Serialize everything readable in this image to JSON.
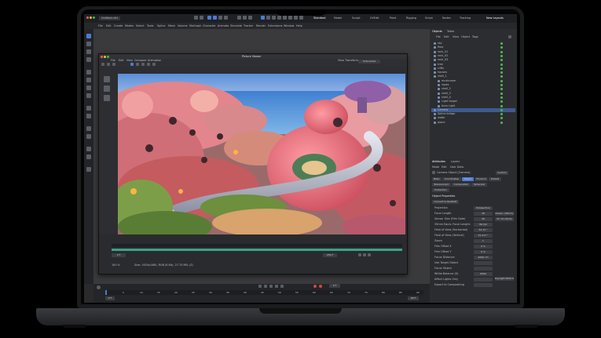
{
  "topbar": {
    "file_tab": "Untitled.c4d",
    "layouts": [
      "Standard",
      "Model",
      "Sculpt",
      "UVEdit",
      "Paint",
      "Rigging",
      "Script",
      "Nodes",
      "Tracking"
    ],
    "new_layouts": "New Layouts"
  },
  "menubar": {
    "items": [
      "File",
      "Edit",
      "Create",
      "Modes",
      "Select",
      "Tools",
      "Spline",
      "Mesh",
      "Volume",
      "MoGraph",
      "Character",
      "Animate",
      "Simulate",
      "Tracker",
      "Render",
      "Extensions",
      "Window",
      "Help"
    ]
  },
  "picture_viewer": {
    "title": "Picture Viewer",
    "menu": [
      "File",
      "Edit",
      "View",
      "Compare",
      "Animation"
    ],
    "view_transform_label": "View Transform",
    "view_transform_value": "Untouched",
    "zoom": "100 %",
    "status": "Size: 1920x1080, RGB (8 Bit), 27.75 MB; (Z)",
    "frame": "0 F",
    "end_frame": "250 F"
  },
  "objects_panel": {
    "tabs": [
      "Objects",
      "Takes"
    ],
    "menu": [
      "File",
      "Edit",
      "View",
      "Object",
      "Tags"
    ],
    "rows": [
      "sky",
      "floor",
      "rock_01",
      "rock_02",
      "rock_03",
      "tree",
      "cliffs",
      "houses",
      "shell_1",
      "mushroom",
      "ropes",
      "shell_2",
      "shell_3",
      "shell_4",
      "Light target",
      "Area Light",
      "Camera",
      "Spline bridge",
      "water",
      "plane"
    ]
  },
  "attributes_panel": {
    "tabs": [
      "Attributes",
      "Layers"
    ],
    "menu": [
      "Mode",
      "Edit",
      "User Data"
    ],
    "object_name": "Camera Object [Camera]",
    "preset": "Custom",
    "sub_tabs": [
      "Basic",
      "Coordinates",
      "Object",
      "Physical",
      "Details",
      "Stereoscopic",
      "Composition",
      "Spherical"
    ],
    "sub_tab2": "Protection",
    "section": "Object Properties",
    "convert_btn": "Convert to Redshift",
    "props": [
      {
        "label": "Projection",
        "value": "Perspective"
      },
      {
        "label": "Focal Length",
        "value": "36"
      },
      {
        "label": "Sensor Size (Film Gate)",
        "value": "36"
      },
      {
        "label": "35mm Equiv. Focal Length:",
        "value": "36 mm"
      },
      {
        "label": "Field of View (Horizontal)",
        "value": "53.13 °"
      },
      {
        "label": "Field of View (Vertical)",
        "value": "31.417 °"
      },
      {
        "label": "Zoom",
        "value": "1"
      },
      {
        "label": "Film Offset X",
        "value": "0 %"
      },
      {
        "label": "Film Offset Y",
        "value": "0 %"
      },
      {
        "label": "Focus Distance",
        "value": "2000 cm"
      },
      {
        "label": "Use Target Object",
        "value": ""
      },
      {
        "label": "Focus Object",
        "value": ""
      },
      {
        "label": "White Balance (K)",
        "value": "6500"
      },
      {
        "label": "Affect Lights Only",
        "value": ""
      },
      {
        "label": "Export to Compositing",
        "value": ""
      }
    ],
    "focal_preset": "Classic (36mm)",
    "sensor_preset": "35 mm Photo",
    "wb_preset": "Daylight 6500 K"
  },
  "timeline": {
    "current": "0 F",
    "start": "0 F",
    "end": "90 F",
    "ticks": [
      "0",
      "5",
      "10",
      "15",
      "20",
      "25",
      "30",
      "35",
      "40",
      "45",
      "50",
      "55",
      "60",
      "65",
      "70",
      "75",
      "80",
      "85",
      "90"
    ]
  }
}
